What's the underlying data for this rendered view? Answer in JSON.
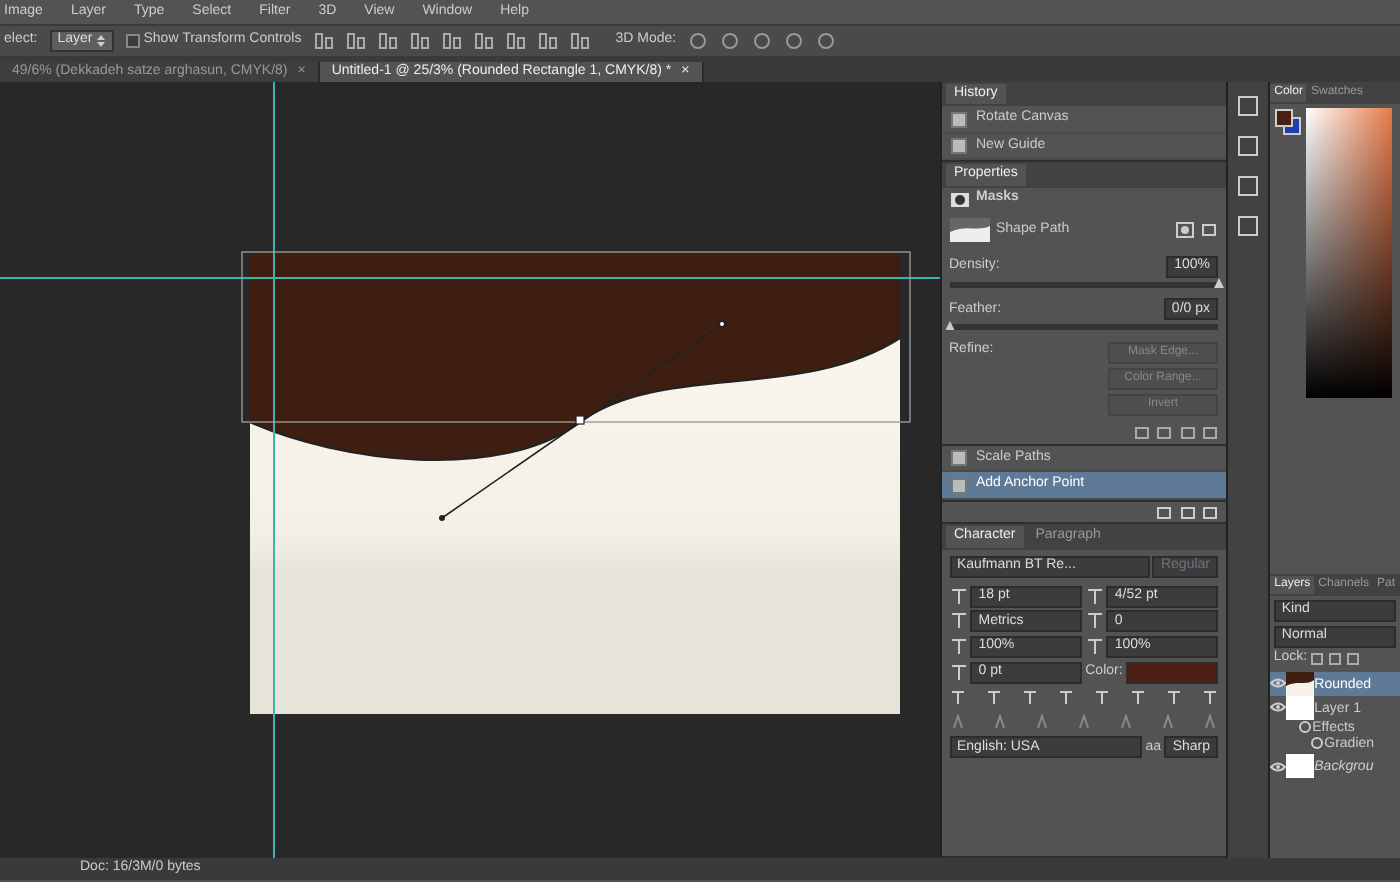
{
  "menu": [
    "Image",
    "Layer",
    "Type",
    "Select",
    "Filter",
    "3D",
    "View",
    "Window",
    "Help"
  ],
  "options_bar": {
    "select_label": "elect:",
    "select_value": "Layer",
    "transform_controls": {
      "label": "Show Transform Controls",
      "checked": false
    },
    "mode_label": "3D Mode:"
  },
  "doc_tabs": [
    {
      "label": "49/6% (Dekkadeh satze arghasun, CMYK/8)",
      "close": "×",
      "selected": false
    },
    {
      "label": "Untitled-1 @ 25/3% (Rounded Rectangle 1, CMYK/8) *",
      "close": "×",
      "selected": true
    }
  ],
  "history": {
    "title": "History",
    "items": [
      {
        "label": "Rotate Canvas",
        "selected": false
      },
      {
        "label": "New Guide",
        "selected": false
      }
    ],
    "items_lower": [
      {
        "label": "Scale Paths",
        "selected": false
      },
      {
        "label": "Add Anchor Point",
        "selected": true
      }
    ]
  },
  "properties": {
    "title": "Properties",
    "section": "Masks",
    "mask_label": "Shape Path",
    "sliders": [
      {
        "label": "Density:",
        "value": "100%",
        "level": 1
      },
      {
        "label": "Feather:",
        "value": "0/0 px",
        "level": 0
      }
    ],
    "refine_label": "Refine:",
    "buttons": [
      {
        "label": "Mask Edge...",
        "disabled": true
      },
      {
        "label": "Color Range...",
        "disabled": true
      },
      {
        "label": "Invert",
        "disabled": true
      }
    ]
  },
  "character": {
    "tabs": [
      {
        "label": "Character",
        "selected": true
      },
      {
        "label": "Paragraph",
        "selected": false
      }
    ],
    "font": "Kaufmann BT Re...",
    "style": "Regular",
    "fields": [
      {
        "value": "18 pt"
      },
      {
        "value": "4/52 pt"
      },
      {
        "value": "Metrics"
      },
      {
        "value": "0"
      },
      {
        "value": "100%"
      },
      {
        "value": "100%"
      },
      {
        "value": "0 pt"
      }
    ],
    "color_label": "Color:",
    "color": "#4a1e12",
    "language": "English: USA",
    "aa": "aa",
    "antialias": "Sharp"
  },
  "color_panel": {
    "tabs": [
      {
        "label": "Color",
        "selected": true
      },
      {
        "label": "Swatches",
        "selected": false
      }
    ]
  },
  "layers_panel": {
    "tabs": [
      {
        "label": "Layers",
        "selected": true
      },
      {
        "label": "Channels",
        "selected": false
      },
      {
        "label": "Pat",
        "selected": false
      }
    ],
    "filter": "Kind",
    "blend": "Normal",
    "lock_label": "Lock:",
    "layers": [
      {
        "name": "Rounded",
        "kind": "shape",
        "selected": true
      },
      {
        "name": "Layer 1",
        "kind": "layer",
        "selected": false
      },
      {
        "name": "Effects",
        "kind": "effects",
        "selected": false
      },
      {
        "name": "Gradien",
        "kind": "effect",
        "selected": false
      },
      {
        "name": "Backgrou",
        "kind": "background",
        "selected": false
      }
    ]
  },
  "status_bar": {
    "doc": "Doc: 16/3M/0 bytes"
  }
}
